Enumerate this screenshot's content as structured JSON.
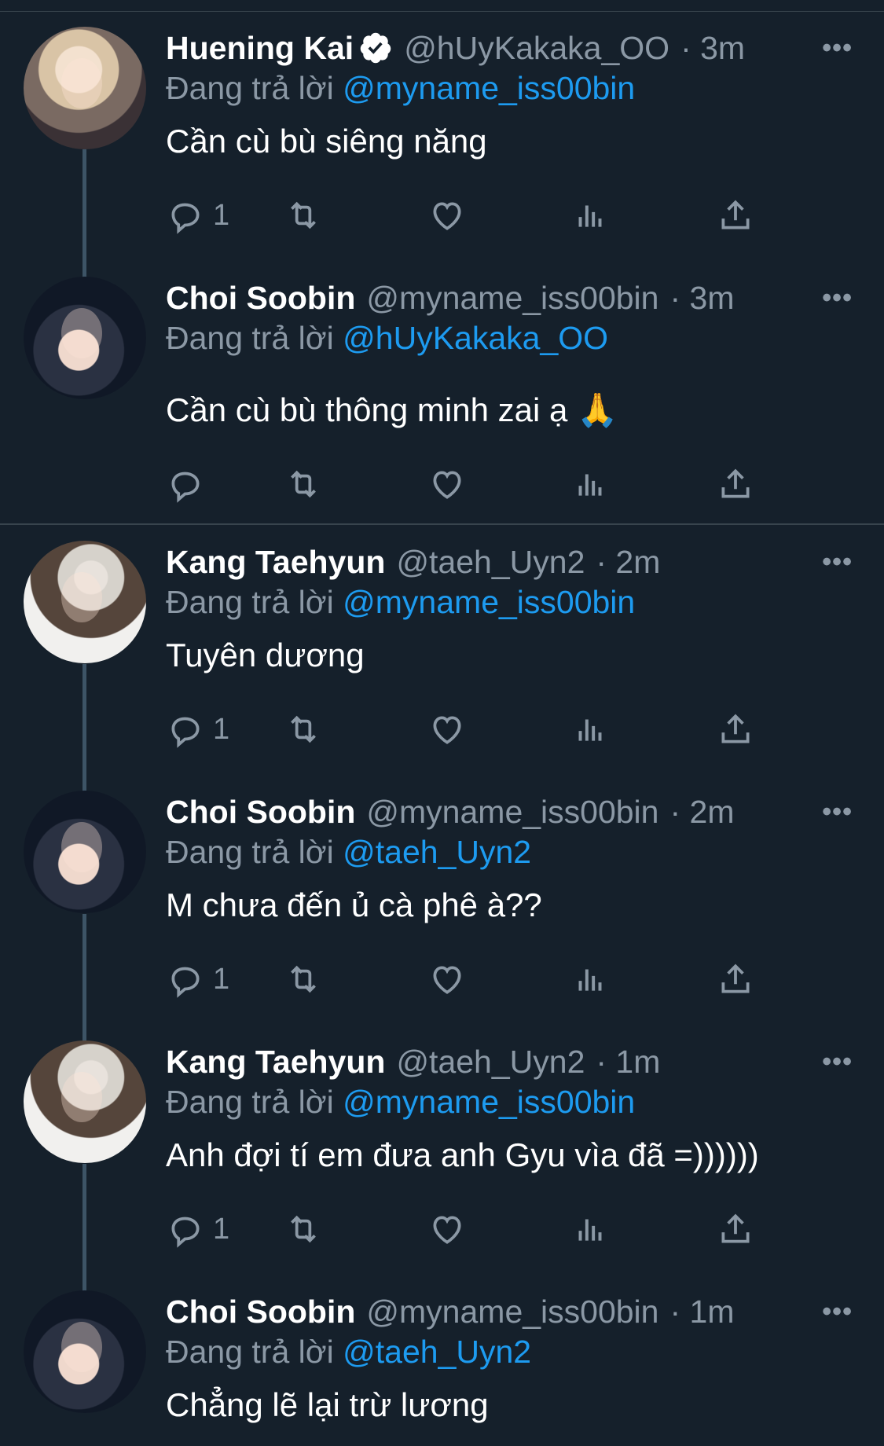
{
  "tweets": [
    {
      "name": "Huening Kai",
      "verified": true,
      "handle": "@hUyKakaka_OO",
      "time": "· 3m",
      "replying_prefix": "Đang trả lời",
      "replying_to": "@myname_iss00bin",
      "text": "Cần cù bù siêng năng",
      "reply_count": "1",
      "avatar": "huening-kai-photo"
    },
    {
      "name": "Choi Soobin",
      "verified": false,
      "handle": "@myname_iss00bin",
      "time": "· 3m",
      "replying_prefix": "Đang trả lời",
      "replying_to": "@hUyKakaka_OO",
      "text": "Cần cù bù thông minh zai ạ 🙏",
      "reply_count": "",
      "avatar": "choi-soobin-photo"
    },
    {
      "name": "Kang Taehyun",
      "verified": false,
      "handle": "@taeh_Uyn2",
      "time": "· 2m",
      "replying_prefix": "Đang trả lời",
      "replying_to": "@myname_iss00bin",
      "text": "Tuyên dương",
      "reply_count": "1",
      "avatar": "kang-taehyun-photo"
    },
    {
      "name": "Choi Soobin",
      "verified": false,
      "handle": "@myname_iss00bin",
      "time": "· 2m",
      "replying_prefix": "Đang trả lời",
      "replying_to": "@taeh_Uyn2",
      "text": "M chưa đến ủ cà phê à??",
      "reply_count": "1",
      "avatar": "choi-soobin-photo"
    },
    {
      "name": "Kang Taehyun",
      "verified": false,
      "handle": "@taeh_Uyn2",
      "time": "· 1m",
      "replying_prefix": "Đang trả lời",
      "replying_to": "@myname_iss00bin",
      "text": "Anh đợi tí em đưa anh Gyu vìa đã =))))))",
      "reply_count": "1",
      "avatar": "kang-taehyun-photo"
    },
    {
      "name": "Choi Soobin",
      "verified": false,
      "handle": "@myname_iss00bin",
      "time": "· 1m",
      "replying_prefix": "Đang trả lời",
      "replying_to": "@taeh_Uyn2",
      "text": "Chẳng lẽ lại trừ lương",
      "reply_count": "",
      "avatar": "choi-soobin-photo"
    }
  ],
  "more_label": "•••",
  "colors": {
    "background": "#15202b",
    "secondary_text": "#8b98a5",
    "link": "#1d9bf0",
    "divider": "#38444d",
    "thread_line": "#3d5466"
  }
}
